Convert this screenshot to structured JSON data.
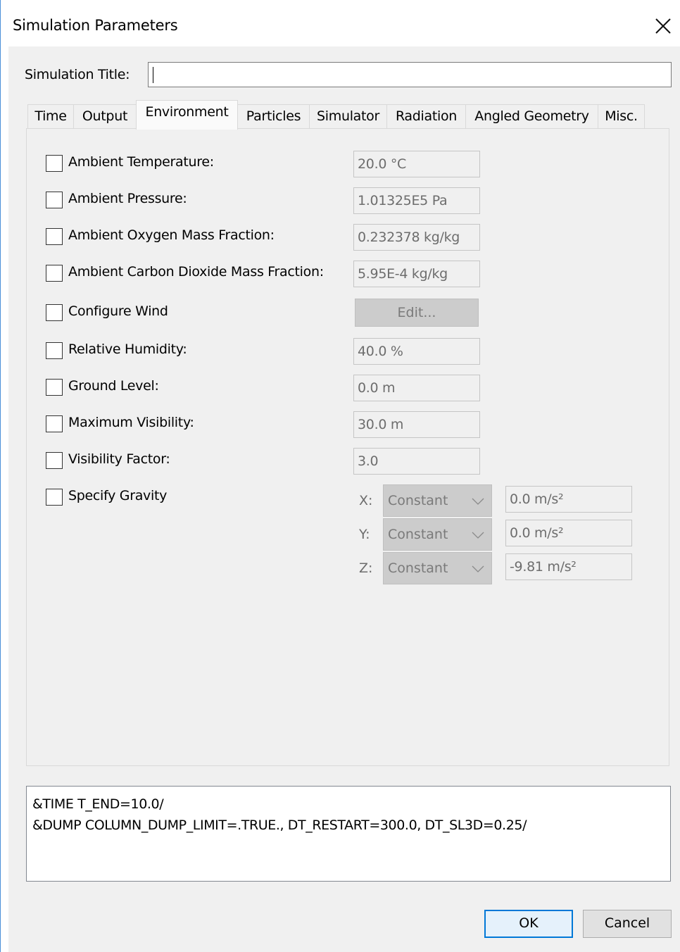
{
  "window": {
    "title": "Simulation Parameters"
  },
  "simulation_title": {
    "label": "Simulation Title:",
    "value": ""
  },
  "tabs": [
    {
      "label": "Time"
    },
    {
      "label": "Output"
    },
    {
      "label": "Environment",
      "active": true
    },
    {
      "label": "Particles"
    },
    {
      "label": "Simulator"
    },
    {
      "label": "Radiation"
    },
    {
      "label": "Angled Geometry"
    },
    {
      "label": "Misc."
    }
  ],
  "environment": {
    "ambient_temperature": {
      "label": "Ambient Temperature:",
      "value": "20.0 °C",
      "checked": false
    },
    "ambient_pressure": {
      "label": "Ambient Pressure:",
      "value": "1.01325E5 Pa",
      "checked": false
    },
    "ambient_oxygen": {
      "label": "Ambient Oxygen Mass Fraction:",
      "value": "0.232378 kg/kg",
      "checked": false
    },
    "ambient_co2": {
      "label": "Ambient Carbon Dioxide Mass Fraction:",
      "value": "5.95E-4 kg/kg",
      "checked": false
    },
    "configure_wind": {
      "label": "Configure Wind",
      "button": "Edit...",
      "checked": false
    },
    "relative_humidity": {
      "label": "Relative Humidity:",
      "value": "40.0 %",
      "checked": false
    },
    "ground_level": {
      "label": "Ground Level:",
      "value": "0.0 m",
      "checked": false
    },
    "maximum_visibility": {
      "label": "Maximum Visibility:",
      "value": "30.0 m",
      "checked": false
    },
    "visibility_factor": {
      "label": "Visibility Factor:",
      "value": "3.0",
      "checked": false
    },
    "gravity": {
      "label": "Specify Gravity",
      "checked": false,
      "x": {
        "label": "X:",
        "mode": "Constant",
        "value": "0.0 m/s²"
      },
      "y": {
        "label": "Y:",
        "mode": "Constant",
        "value": "0.0 m/s²"
      },
      "z": {
        "label": "Z:",
        "mode": "Constant",
        "value": "-9.81 m/s²"
      }
    }
  },
  "preview": {
    "line1": "&TIME T_END=10.0/",
    "line2": "&DUMP COLUMN_DUMP_LIMIT=.TRUE., DT_RESTART=300.0, DT_SL3D=0.25/"
  },
  "buttons": {
    "ok": "OK",
    "cancel": "Cancel"
  },
  "icons": {
    "close": "close-icon",
    "chevron": "chevron-down-icon"
  }
}
